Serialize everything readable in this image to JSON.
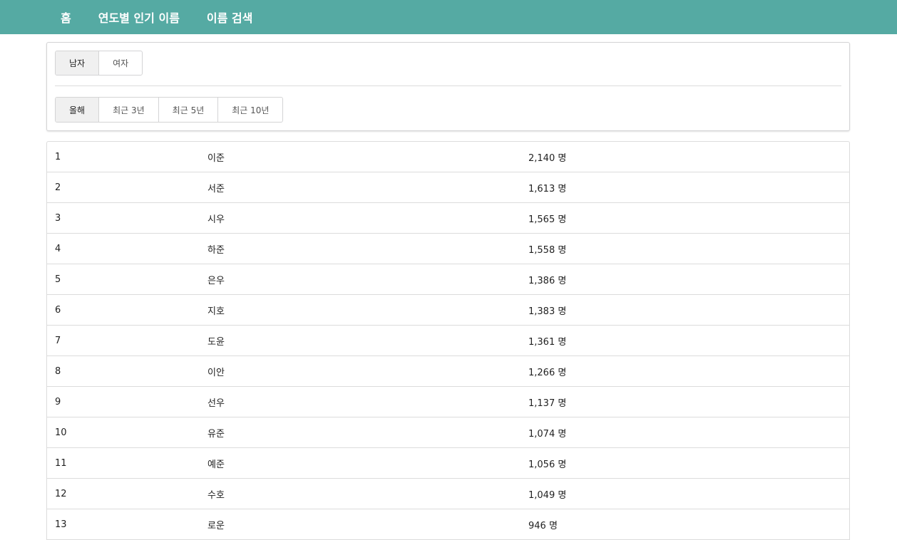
{
  "nav": {
    "items": [
      "홈",
      "연도별 인기 이름",
      "이름 검색"
    ]
  },
  "filters": {
    "gender": {
      "options": [
        "남자",
        "여자"
      ],
      "selected": "남자"
    },
    "period": {
      "options": [
        "올해",
        "최근 3년",
        "최근 5년",
        "최근 10년"
      ],
      "selected": "올해"
    }
  },
  "rankings": [
    {
      "rank": "1",
      "name": "이준",
      "count": "2,140 명"
    },
    {
      "rank": "2",
      "name": "서준",
      "count": "1,613 명"
    },
    {
      "rank": "3",
      "name": "시우",
      "count": "1,565 명"
    },
    {
      "rank": "4",
      "name": "하준",
      "count": "1,558 명"
    },
    {
      "rank": "5",
      "name": "은우",
      "count": "1,386 명"
    },
    {
      "rank": "6",
      "name": "지호",
      "count": "1,383 명"
    },
    {
      "rank": "7",
      "name": "도윤",
      "count": "1,361 명"
    },
    {
      "rank": "8",
      "name": "이안",
      "count": "1,266 명"
    },
    {
      "rank": "9",
      "name": "선우",
      "count": "1,137 명"
    },
    {
      "rank": "10",
      "name": "유준",
      "count": "1,074 명"
    },
    {
      "rank": "11",
      "name": "예준",
      "count": "1,056 명"
    },
    {
      "rank": "12",
      "name": "수호",
      "count": "1,049 명"
    },
    {
      "rank": "13",
      "name": "로운",
      "count": "946 명"
    }
  ],
  "colors": {
    "navbar": "#55aaa3",
    "active_button": "#f0f0f0",
    "border": "#dcdcdc"
  }
}
